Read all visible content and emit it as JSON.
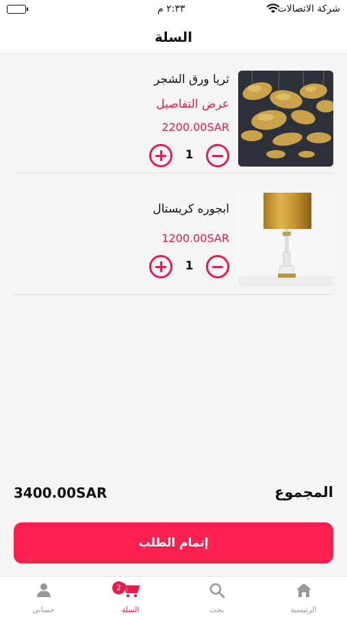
{
  "status_bar": {
    "carrier": "شركة الاتصالات",
    "time": "٢:٣٣ م"
  },
  "header": {
    "title": "السلة"
  },
  "cart": {
    "items": [
      {
        "name": "ثريا ورق الشجر",
        "details_link": "عرض التفاصيل",
        "price": "2200.00SAR",
        "quantity": "1",
        "image": "gold-leaf-chandelier"
      },
      {
        "name": "ابجوره كريستال",
        "price": "1200.00SAR",
        "quantity": "1",
        "image": "crystal-lamp-gold-shade"
      }
    ]
  },
  "summary": {
    "total_label": "المجموع",
    "total_value": "3400.00SAR"
  },
  "checkout": {
    "label": "إتمام الطلب"
  },
  "tab_bar": {
    "tabs": [
      {
        "label": "الرئيسية",
        "icon": "home-icon"
      },
      {
        "label": "بحث",
        "icon": "search-icon"
      },
      {
        "label": "السلة",
        "icon": "cart-icon",
        "badge": "2",
        "active": true
      },
      {
        "label": "حسابي",
        "icon": "person-icon"
      }
    ]
  },
  "colors": {
    "accent": "#e8194b",
    "button": "#fd1f4e",
    "background": "#f5f5f5",
    "inactive_tab": "#999999"
  }
}
